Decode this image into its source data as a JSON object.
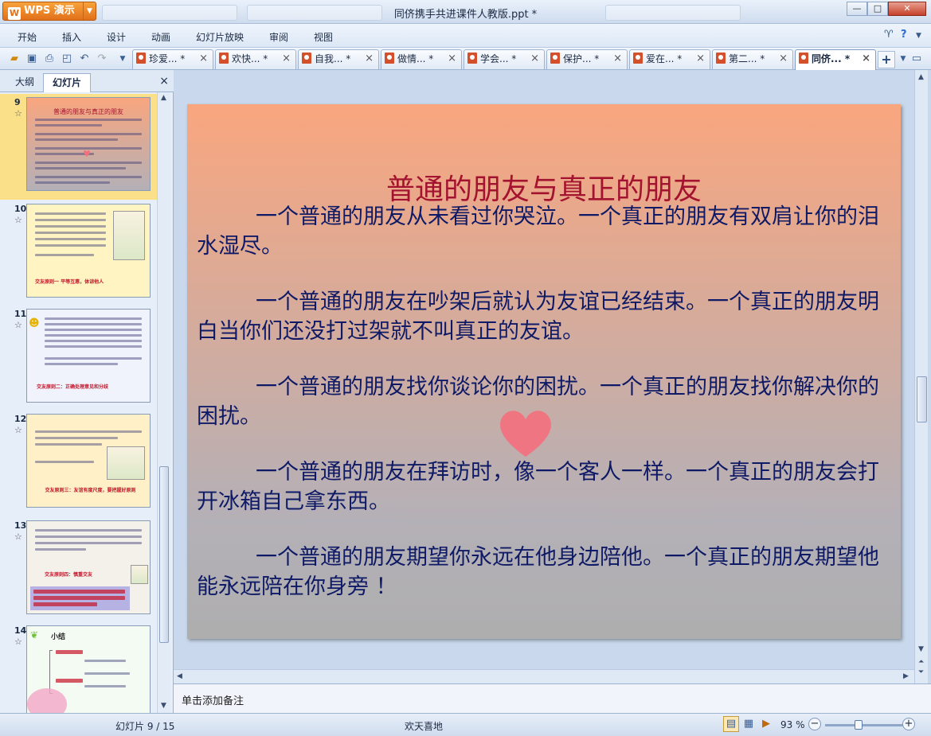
{
  "app": {
    "menu_label": "WPS 演示",
    "logo_glyph": "W",
    "window_title": "同侪携手共进课件人教版.ppt *"
  },
  "menu": [
    "开始",
    "插入",
    "设计",
    "动画",
    "幻灯片放映",
    "审阅",
    "视图"
  ],
  "doc_tabs": [
    {
      "label": "珍爱... *",
      "active": false
    },
    {
      "label": "欢快... *",
      "active": false
    },
    {
      "label": "自我... *",
      "active": false
    },
    {
      "label": "做情... *",
      "active": false
    },
    {
      "label": "学会... *",
      "active": false
    },
    {
      "label": "保护... *",
      "active": false
    },
    {
      "label": "爱在... *",
      "active": false
    },
    {
      "label": "第二... *",
      "active": false
    },
    {
      "label": "同侪... *",
      "active": true
    }
  ],
  "left_panel": {
    "tab_outline": "大纲",
    "tab_slides": "幻灯片",
    "thumbnails": [
      {
        "number": "9",
        "selected": true,
        "bg": "linear-gradient(#f9a67e,#b4b0b7)",
        "title": "普通的朋友与真正的朋友",
        "footer": ""
      },
      {
        "number": "10",
        "selected": false,
        "bg": "#fff4c2",
        "title": "",
        "footer": "交友原则一   平等互惠，体谅他人"
      },
      {
        "number": "11",
        "selected": false,
        "bg": "#f0f3fb",
        "title": "",
        "footer": "交友原则二：正确处理意见和分歧"
      },
      {
        "number": "12",
        "selected": false,
        "bg": "#fff0c8",
        "title": "",
        "footer": "交友原则三：友谊有度尺度，要把握好原则"
      },
      {
        "number": "13",
        "selected": false,
        "bg": "#f3f1ea",
        "title": "",
        "footer": "交友原则四：慎重交友"
      },
      {
        "number": "14",
        "selected": false,
        "bg": "#f3fbf3",
        "title": "小结",
        "footer": ""
      }
    ]
  },
  "slide": {
    "title": "普通的朋友与真正的朋友",
    "paragraphs": [
      "一个普通的朋友从未看过你哭泣。一个真正的朋友有双肩让你的泪水湿尽。",
      "一个普通的朋友在吵架后就认为友谊已经结束。一个真正的朋友明白当你们还没打过架就不叫真正的友谊。",
      "一个普通的朋友找你谈论你的困扰。一个真正的朋友找你解决你的困扰。",
      "一个普通的朋友在拜访时，像一个客人一样。一个真正的朋友会打开冰箱自己拿东西。",
      "一个普通的朋友期望你永远在他身边陪他。一个真正的朋友期望他能永远陪在你身旁 ！"
    ],
    "colors": {
      "title": "#a3122e",
      "body": "#0e1a66",
      "heart": "#f36f7c"
    }
  },
  "notes": {
    "placeholder": "单击添加备注"
  },
  "status": {
    "slide_info": "幻灯片 9 / 15",
    "theme": "欢天喜地",
    "zoom": "93 %",
    "zoom_fraction": 0.42
  }
}
